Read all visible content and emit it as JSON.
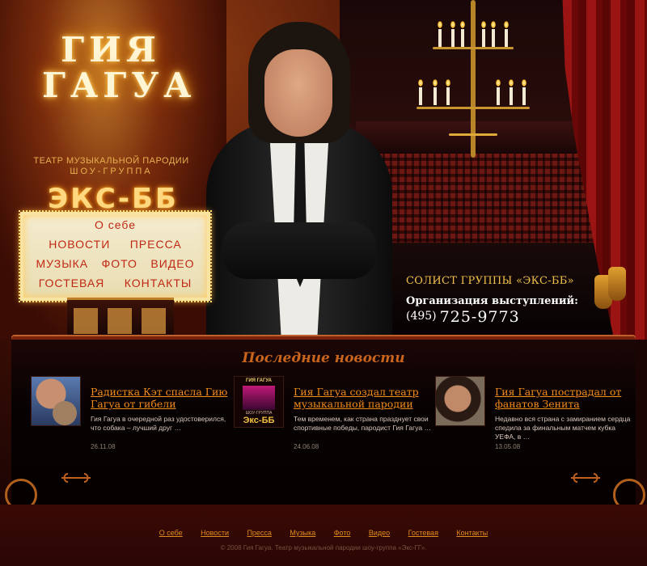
{
  "brand": {
    "name_line1": "ГИЯ",
    "name_line2": "ГАГУА",
    "subtitle_line1": "ТЕАТР МУЗЫКАЛЬНОЙ ПАРОДИИ",
    "subtitle_line2": "ШОУ-ГРУППА",
    "group_name": "ЭКС-ББ"
  },
  "menu": {
    "about": "О себе",
    "news": "НОВОСТИ",
    "press": "ПРЕССА",
    "music": "МУЗЫКА",
    "photo": "ФОТО",
    "video": "ВИДЕО",
    "guestbook": "ГОСТЕВАЯ",
    "contacts": "КОНТАКТЫ"
  },
  "contact": {
    "soloist": "СОЛИСТ ГРУППЫ «ЭКС-ББ»",
    "org_label": "Организация выступлений:",
    "phone_code": "(495)",
    "phone_number": "725-9773"
  },
  "news": {
    "title": "Последние новости",
    "items": [
      {
        "headline": "Радистка Кэт спасла Гию Гагуа от гибели",
        "excerpt": "Гия Гагуа в очередной раз удостоверился, что собака – лучший друг …",
        "date": "26.11.08"
      },
      {
        "headline": "Гия Гагуа создал театр музыкальной пародии",
        "excerpt": "Тем временем, как страна празднует свои спортивные победы, пародист Гия Гагуа …",
        "date": "24.06.08",
        "thumb_top": "ГИЯ ГАГУА",
        "thumb_mid": "ШОУ-ГРУППА",
        "thumb_bottom": "Экс-ББ"
      },
      {
        "headline": "Гия Гагуа пострадал от фанатов Зенита",
        "excerpt": "Недавно вся страна с замиранием сердца спедила за финальным матчем кубка УЕФА, в …",
        "date": "13.05.08"
      }
    ]
  },
  "footer": {
    "links": [
      "О себе",
      "Новости",
      "Пресса",
      "Музыка",
      "Фото",
      "Видео",
      "Гостевая",
      "Контакты"
    ],
    "copyright": "© 2008 Гия Гагуа. Театр музыкальной пародии шоу-группа «Экс-ГГ»."
  },
  "colors": {
    "accent": "#f28c1c",
    "gold": "#f2c049",
    "marquee_text": "#c02814",
    "background": "#2a0606"
  }
}
